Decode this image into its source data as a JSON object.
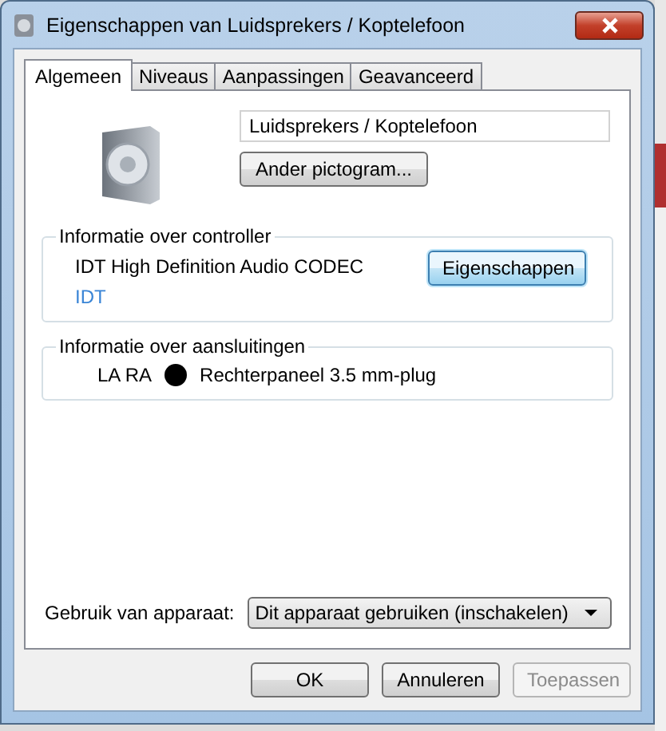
{
  "window": {
    "title": "Eigenschappen van Luidsprekers / Koptelefoon"
  },
  "tabs": [
    {
      "label": "Algemeen",
      "selected": true
    },
    {
      "label": "Niveaus",
      "selected": false
    },
    {
      "label": "Aanpassingen",
      "selected": false
    },
    {
      "label": "Geavanceerd",
      "selected": false
    }
  ],
  "device_name": {
    "value": "Luidsprekers / Koptelefoon"
  },
  "change_icon_button": "Ander pictogram...",
  "controller": {
    "heading": "Informatie over controller",
    "name": "IDT High Definition Audio CODEC",
    "link": "IDT",
    "button": "Eigenschappen"
  },
  "jacks": {
    "heading": "Informatie over aansluitingen",
    "items": [
      {
        "channels": "LA RA",
        "color": "#000000",
        "description": "Rechterpaneel 3.5 mm-plug"
      }
    ]
  },
  "device_usage": {
    "label": "Gebruik van apparaat:",
    "value": "Dit apparaat gebruiken (inschakelen)"
  },
  "buttons": [
    {
      "label": "OK",
      "disabled": false
    },
    {
      "label": "Annuleren",
      "disabled": false
    },
    {
      "label": "Toepassen",
      "disabled": true
    }
  ]
}
